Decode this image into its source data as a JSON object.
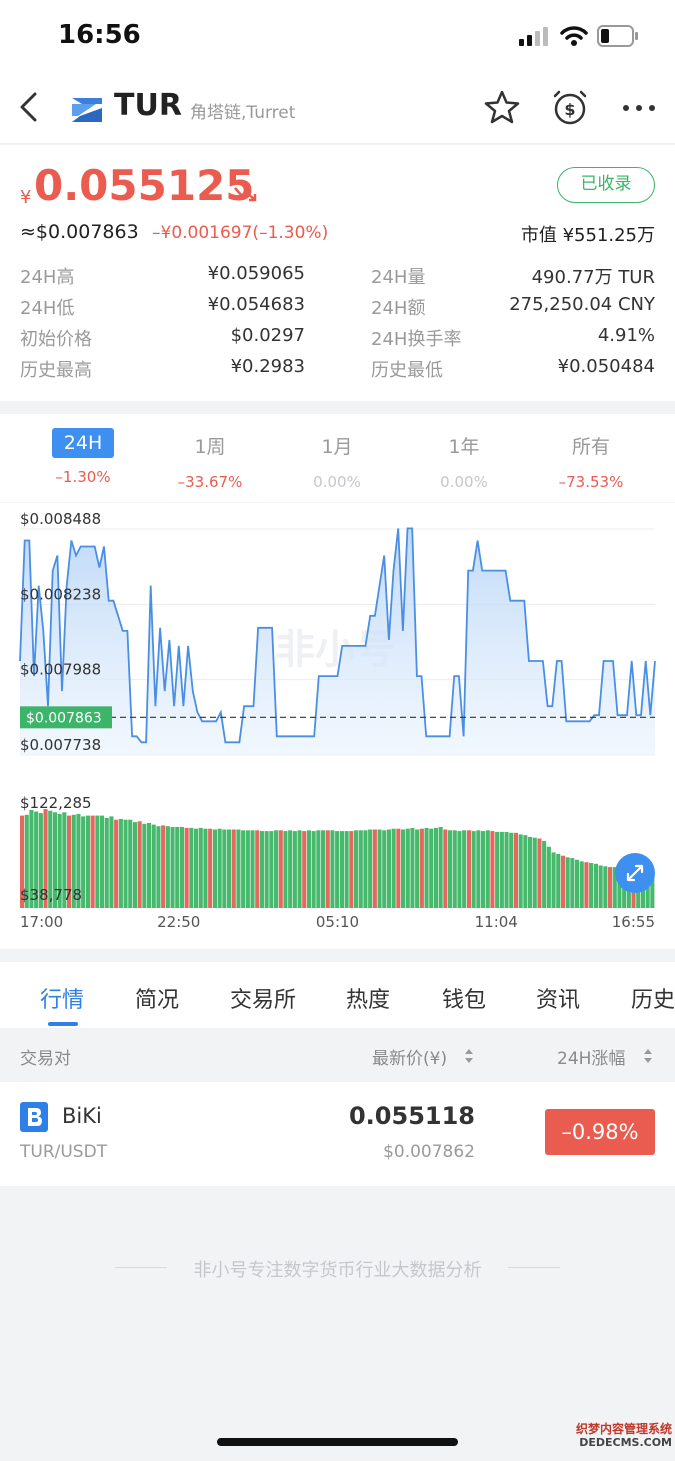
{
  "status_bar": {
    "time": "16:56"
  },
  "header": {
    "symbol": "TUR",
    "subtitle": "角塔链,Turret"
  },
  "quote": {
    "currency_symbol": "¥",
    "price": "0.055125",
    "collected_label": "已收录",
    "usd_price": "≈$0.007863",
    "change": "–¥0.001697(–1.30%)",
    "market_cap": "市值 ¥551.25万"
  },
  "stats": [
    {
      "label": "24H高",
      "value": "¥0.059065"
    },
    {
      "label": "24H量",
      "value": "490.77万 TUR"
    },
    {
      "label": "24H低",
      "value": "¥0.054683"
    },
    {
      "label": "24H额",
      "value": "275,250.04 CNY"
    },
    {
      "label": "初始价格",
      "value": "$0.0297"
    },
    {
      "label": "24H换手率",
      "value": "4.91%"
    },
    {
      "label": "历史最高",
      "value": "¥0.2983"
    },
    {
      "label": "历史最低",
      "value": "¥0.050484"
    }
  ],
  "periods": [
    {
      "label": "24H",
      "change": "–1.30%",
      "color": "#ea5b50",
      "active": true
    },
    {
      "label": "1周",
      "change": "–33.67%",
      "color": "#ea5b50",
      "active": false
    },
    {
      "label": "1月",
      "change": "0.00%",
      "color": "#c4c7cc",
      "active": false
    },
    {
      "label": "1年",
      "change": "0.00%",
      "color": "#c4c7cc",
      "active": false
    },
    {
      "label": "所有",
      "change": "–73.53%",
      "color": "#ea5b50",
      "active": false
    }
  ],
  "chart_data": {
    "type": "line",
    "y_ticks": [
      "$0.008488",
      "$0.008238",
      "$0.007988",
      "$0.007738"
    ],
    "current_price_label": "$0.007863",
    "current_price": 0.007863,
    "ylim": [
      0.007738,
      0.008488
    ],
    "x_ticks": [
      "17:00",
      "22:50",
      "05:10",
      "11:04",
      "16:55"
    ],
    "watermark": "非小号",
    "price_series": [
      0.00805,
      0.00845,
      0.00845,
      0.008,
      0.0083,
      0.00815,
      0.0079,
      0.00835,
      0.0084,
      0.00795,
      0.0083,
      0.00845,
      0.0084,
      0.00843,
      0.00843,
      0.00843,
      0.00843,
      0.00836,
      0.00843,
      0.00825,
      0.00825,
      0.0082,
      0.00815,
      0.00815,
      0.0078,
      0.0078,
      0.00778,
      0.00778,
      0.0083,
      0.0079,
      0.00816,
      0.00795,
      0.00812,
      0.0079,
      0.0081,
      0.0079,
      0.0081,
      0.00795,
      0.00788,
      0.00785,
      0.00785,
      0.00785,
      0.00785,
      0.00788,
      0.00778,
      0.00778,
      0.00778,
      0.00778,
      0.0079,
      0.0079,
      0.0079,
      0.00816,
      0.00816,
      0.00816,
      0.00816,
      0.0078,
      0.0078,
      0.0078,
      0.0078,
      0.0078,
      0.0078,
      0.0078,
      0.0078,
      0.0078,
      0.008,
      0.008,
      0.008,
      0.008,
      0.008,
      0.0081,
      0.0081,
      0.0081,
      0.0081,
      0.0081,
      0.0081,
      0.0082,
      0.0082,
      0.0083,
      0.0084,
      0.00812,
      0.00835,
      0.00849,
      0.00815,
      0.00849,
      0.00849,
      0.008,
      0.008,
      0.0078,
      0.0078,
      0.0078,
      0.0078,
      0.0078,
      0.0078,
      0.008,
      0.008,
      0.0078,
      0.00835,
      0.00835,
      0.00845,
      0.00835,
      0.00835,
      0.00835,
      0.00835,
      0.00835,
      0.00835,
      0.00825,
      0.00825,
      0.00825,
      0.00825,
      0.00805,
      0.00805,
      0.00805,
      0.00805,
      0.0079,
      0.0079,
      0.00805,
      0.00805,
      0.00785,
      0.00785,
      0.00785,
      0.00785,
      0.00785,
      0.00785,
      0.00787,
      0.00787,
      0.00805,
      0.00805,
      0.00805,
      0.00787,
      0.00787,
      0.00787,
      0.00805,
      0.00787,
      0.00787,
      0.00805,
      0.00787,
      0.00805
    ],
    "volume_ticks": [
      "$122,285",
      "$38,778"
    ],
    "volume_max": 122285,
    "volume_min": 38778,
    "volume_series": [
      113000,
      114000,
      120000,
      118000,
      116000,
      121000,
      119000,
      117000,
      115000,
      117000,
      113000,
      114000,
      115000,
      112000,
      113000,
      113000,
      113000,
      113000,
      110000,
      112000,
      108000,
      109000,
      108000,
      108000,
      105000,
      106000,
      103000,
      104000,
      102000,
      100000,
      101000,
      100000,
      99000,
      99000,
      99000,
      98000,
      98000,
      97000,
      98000,
      97000,
      97000,
      96000,
      97000,
      96000,
      96000,
      96000,
      96000,
      95000,
      95000,
      95000,
      95000,
      94000,
      94000,
      94000,
      95000,
      95000,
      94000,
      95000,
      94000,
      95000,
      94000,
      95000,
      94000,
      95000,
      95000,
      95000,
      95000,
      94000,
      94000,
      94000,
      94000,
      95000,
      95000,
      95000,
      96000,
      96000,
      96000,
      95000,
      96000,
      97000,
      97000,
      96000,
      97000,
      98000,
      96000,
      97000,
      98000,
      97000,
      98000,
      99000,
      96000,
      95000,
      95000,
      94000,
      95000,
      95000,
      94000,
      95000,
      94000,
      95000,
      94000,
      93000,
      93000,
      93000,
      92000,
      92000,
      90000,
      89000,
      87000,
      86000,
      85000,
      82000,
      75000,
      68000,
      66000,
      64000,
      62000,
      61000,
      59000,
      57000,
      56000,
      55000,
      54000,
      52000,
      51000,
      50000,
      50000,
      49000,
      48000,
      48000,
      47000,
      47000,
      46000,
      46000,
      46000
    ]
  },
  "tabs": [
    "行情",
    "简况",
    "交易所",
    "热度",
    "钱包",
    "资讯",
    "历史"
  ],
  "table": {
    "col_pair": "交易对",
    "col_price": "最新价(¥)",
    "col_change": "24H涨幅",
    "rows": [
      {
        "exchange": "BiKi",
        "pair": "TUR/USDT",
        "price": "0.055118",
        "usd": "$0.007862",
        "change": "–0.98%"
      }
    ]
  },
  "footer": {
    "text": "非小号专注数字货币行业大数据分析"
  },
  "watermark_corner": [
    "织梦内容管理系统",
    "DEDECMS.COM"
  ]
}
